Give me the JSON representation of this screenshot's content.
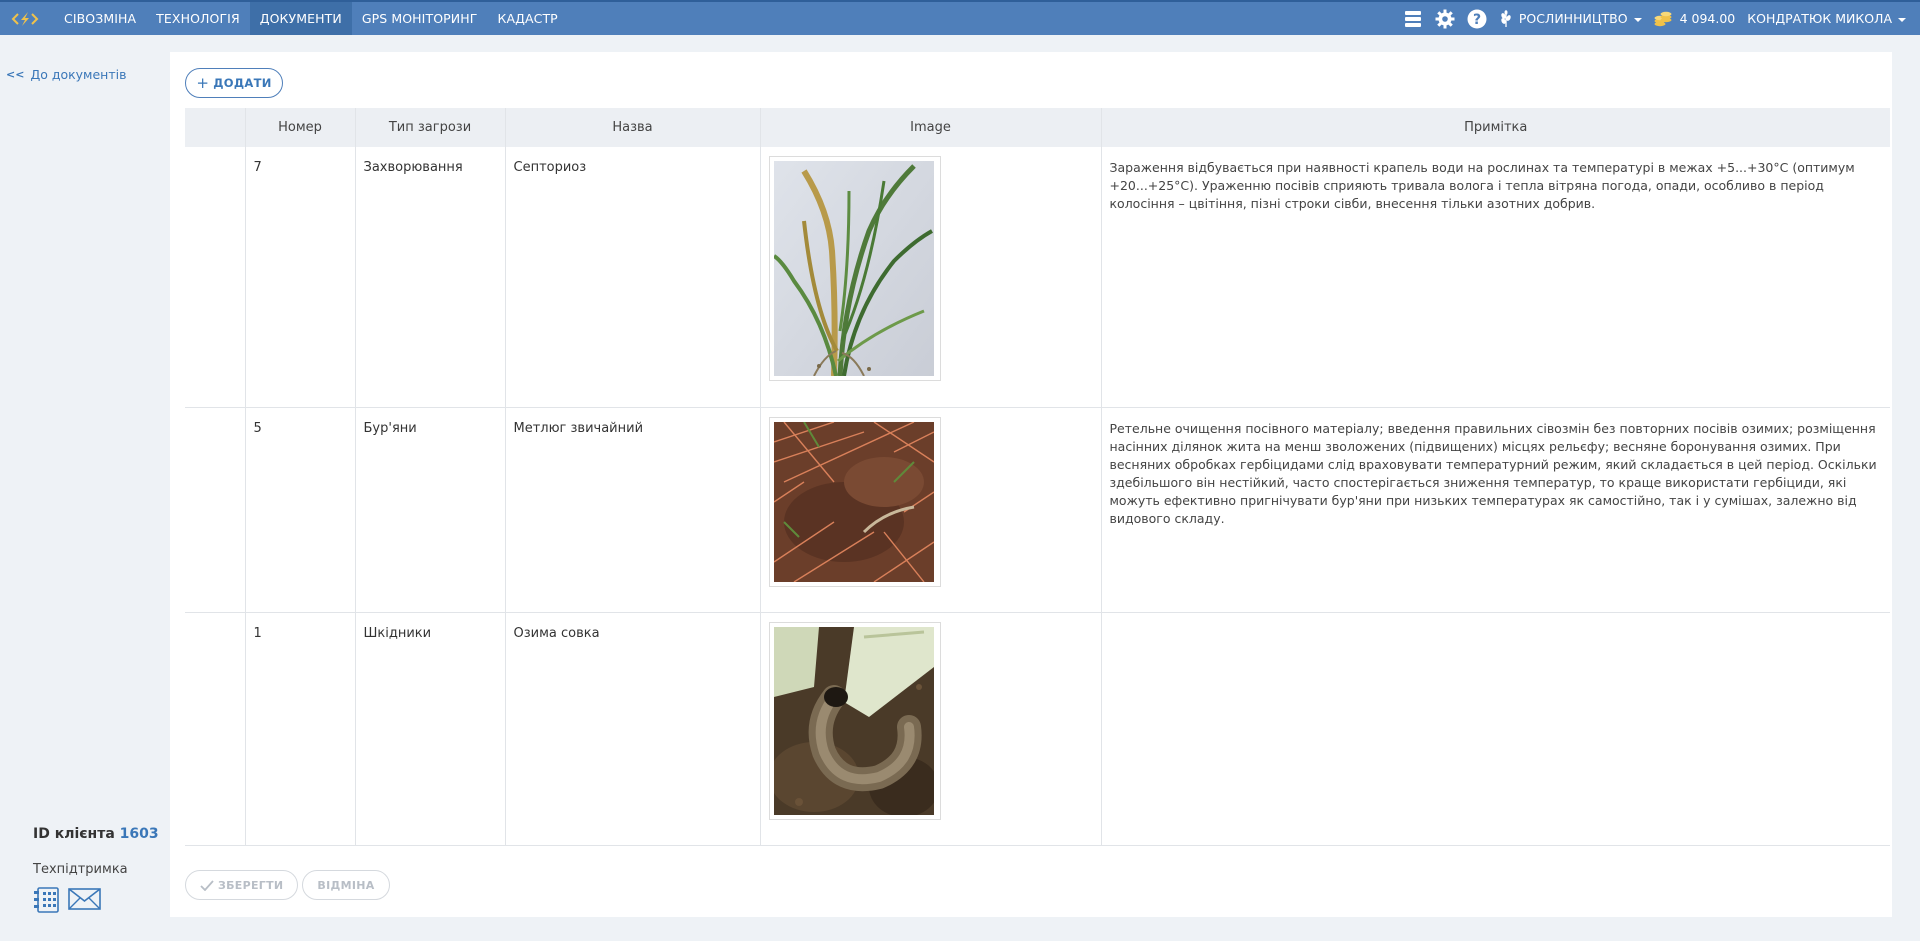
{
  "nav": {
    "items": [
      "СІВОЗМІНА",
      "ТЕХНОЛОГІЯ",
      "ДОКУМЕНТИ",
      "GPS МОНІТОРИНГ",
      "КАДАСТР"
    ],
    "active_index": 2
  },
  "topright": {
    "module": "РОСЛИННИЦТВО",
    "balance": "4 094.00",
    "user": "КОНДРАТЮК МИКОЛА"
  },
  "sidebar": {
    "back_arrows": "<<",
    "back_label": "До документів",
    "client_label": "ID клієнта",
    "client_id": "1603",
    "support_label": "Техпідтримка"
  },
  "toolbar": {
    "add_plus": "+",
    "add_label": "ДОДАТИ",
    "save_label": "ЗБЕРЕГТИ",
    "cancel_label": "ВІДМІНА"
  },
  "table": {
    "headers": [
      "",
      "Номер",
      "Тип загрози",
      "Назва",
      "Image",
      "Примітка"
    ],
    "rows": [
      {
        "number": "7",
        "type": "Захворювання",
        "name": "Септориоз",
        "note": "Зараження відбувається при наявності крапель води на рослинах та температурі в межах +5...+30°С (оптимум +20...+25°С). Ураженню посівів сприяють тривала волога і тепла вітряна погода, опади, особливо в період колосіння – цвітіння, пізні строки сівби, внесення тільки азотних добрив."
      },
      {
        "number": "5",
        "type": "Бур'яни",
        "name": "Метлюг звичайний",
        "note": "Ретельне очищення посівного матеріалу; введення правильних сівозмін без повторних посівів озимих; розміщення насінних ділянок жита на менш зволожених (підвищених) місцях рельєфу; весняне боронування озимих. При весняних обробках гербіцидами слід враховувати температурний режим, який складається в цей період. Оскільки здебільшого він нестійкий, часто спостерігається зниження температур, то краще використати гербіциди, які можуть ефективно пригнічувати бур'яни при низьких температурах як самостійно, так і у сумішах, залежно від видового складу."
      },
      {
        "number": "1",
        "type": "Шкідники",
        "name": "Озима совка",
        "note": ""
      }
    ]
  }
}
